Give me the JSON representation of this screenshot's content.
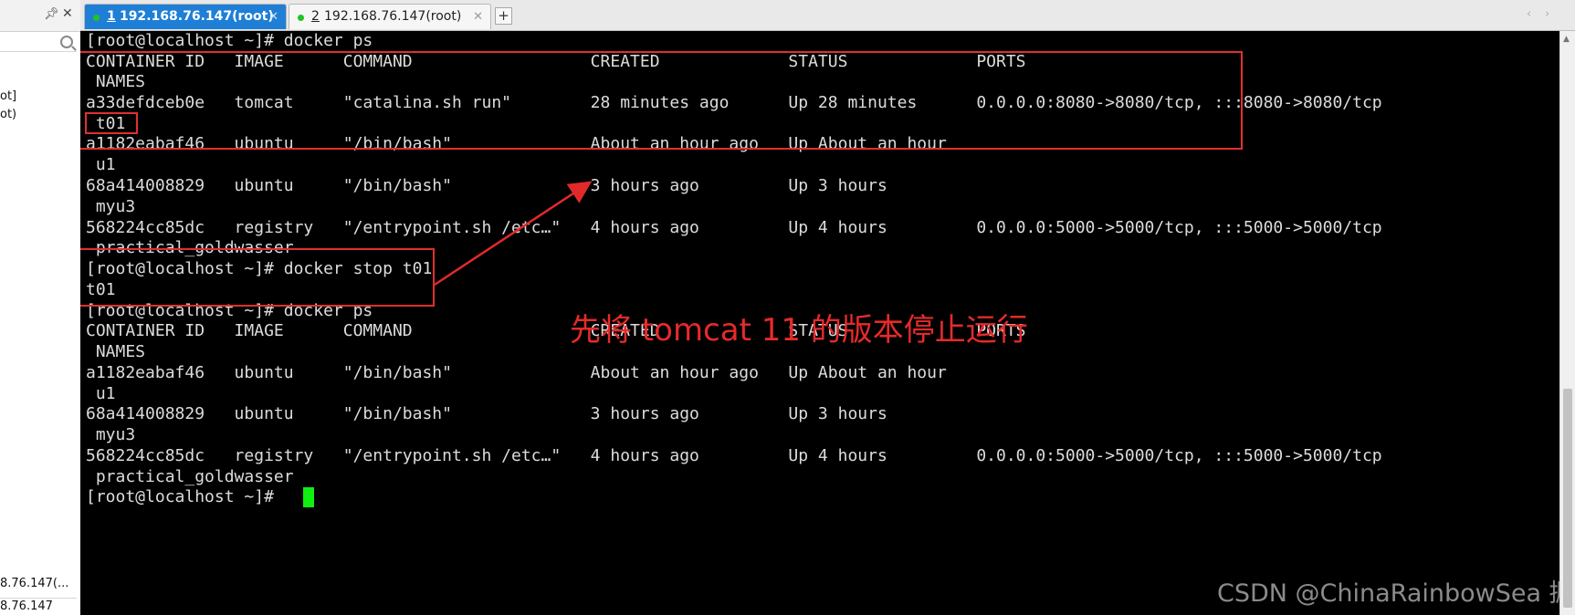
{
  "left_panel": {
    "pin_icon": "pin-icon",
    "close_icon": "close-icon",
    "search_icon": "search-icon",
    "items": [
      "ot]",
      "ot)"
    ],
    "footer": [
      "8.76.147(...",
      "8.76.147"
    ]
  },
  "tabs": [
    {
      "number": "1",
      "label": "192.168.76.147(root)",
      "active": true,
      "status_color": "#22c322"
    },
    {
      "number": "2",
      "label": "192.168.76.147(root)",
      "active": false,
      "status_color": "#22c322"
    }
  ],
  "new_tab_label": "+",
  "nav": {
    "prev": "‹",
    "next": "›"
  },
  "terminal": {
    "lines": [
      "[root@localhost ~]# docker ps",
      "CONTAINER ID   IMAGE      COMMAND                  CREATED             STATUS             PORTS",
      " NAMES",
      "a33defdceb0e   tomcat     \"catalina.sh run\"        28 minutes ago      Up 28 minutes      0.0.0.0:8080->8080/tcp, :::8080->8080/tcp",
      " t01",
      "a1182eabaf46   ubuntu     \"/bin/bash\"              About an hour ago   Up About an hour",
      " u1",
      "68a414008829   ubuntu     \"/bin/bash\"              3 hours ago         Up 3 hours",
      " myu3",
      "568224cc85dc   registry   \"/entrypoint.sh /etc…\"   4 hours ago         Up 4 hours         0.0.0.0:5000->5000/tcp, :::5000->5000/tcp",
      " practical_goldwasser",
      "[root@localhost ~]# docker stop t01",
      "t01",
      "[root@localhost ~]# docker ps",
      "CONTAINER ID   IMAGE      COMMAND                  CREATED             STATUS             PORTS",
      " NAMES",
      "a1182eabaf46   ubuntu     \"/bin/bash\"              About an hour ago   Up About an hour",
      " u1",
      "68a414008829   ubuntu     \"/bin/bash\"              3 hours ago         Up 3 hours",
      " myu3",
      "568224cc85dc   registry   \"/entrypoint.sh /etc…\"   4 hours ago         Up 4 hours         0.0.0.0:5000->5000/tcp, :::5000->5000/tcp",
      " practical_goldwasser",
      "[root@localhost ~]# "
    ],
    "text_color": "#dcdcdc",
    "background": "#000000",
    "cursor_color": "#11ee11"
  },
  "annotation": {
    "text": "先将 tomcat 11 的版本停止运行",
    "color": "#e62a2a"
  },
  "watermark": "CSDN @ChinaRainbowSea 掘金技术社区"
}
